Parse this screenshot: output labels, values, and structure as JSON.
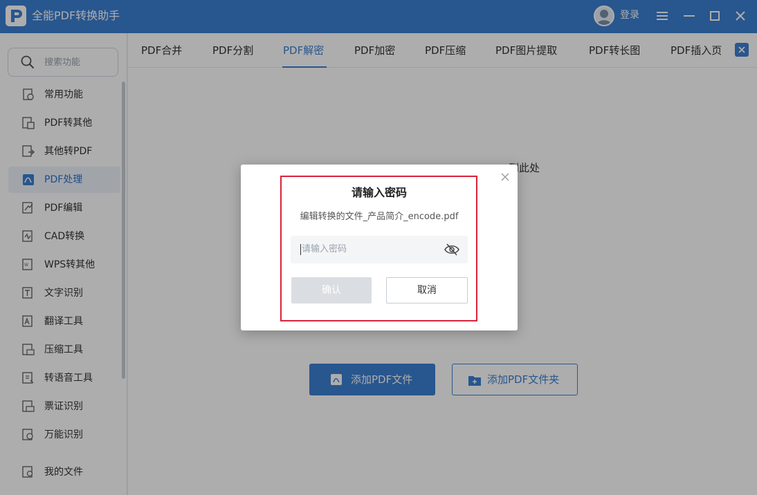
{
  "app": {
    "title": "全能PDF转换助手",
    "login_label": "登录"
  },
  "colors": {
    "brand": "#3b7fd1",
    "highlight_border": "#d9233a"
  },
  "sidebar": {
    "search_placeholder": "搜索功能",
    "items": [
      {
        "label": "常用功能",
        "icon": "star-doc-icon"
      },
      {
        "label": "PDF转其他",
        "icon": "pdf-convert-icon"
      },
      {
        "label": "其他转PDF",
        "icon": "to-pdf-icon"
      },
      {
        "label": "PDF处理",
        "icon": "pdf-process-icon",
        "active": true
      },
      {
        "label": "PDF编辑",
        "icon": "pdf-edit-icon"
      },
      {
        "label": "CAD转换",
        "icon": "cad-icon"
      },
      {
        "label": "WPS转其他",
        "icon": "wps-icon"
      },
      {
        "label": "文字识别",
        "icon": "ocr-icon"
      },
      {
        "label": "翻译工具",
        "icon": "translate-icon"
      },
      {
        "label": "压缩工具",
        "icon": "compress-icon"
      },
      {
        "label": "转语音工具",
        "icon": "voice-icon"
      },
      {
        "label": "票证识别",
        "icon": "ticket-icon"
      },
      {
        "label": "万能识别",
        "icon": "universal-scan-icon"
      },
      {
        "label": "我的文件",
        "icon": "my-files-icon"
      }
    ]
  },
  "tabs": [
    {
      "label": "PDF合并"
    },
    {
      "label": "PDF分割"
    },
    {
      "label": "PDF解密",
      "active": true
    },
    {
      "label": "PDF加密"
    },
    {
      "label": "PDF压缩"
    },
    {
      "label": "PDF图片提取"
    },
    {
      "label": "PDF转长图"
    },
    {
      "label": "PDF插入页"
    }
  ],
  "content": {
    "drop_hint": "到此处",
    "add_file_label": "添加PDF文件",
    "add_folder_label": "添加PDF文件夹"
  },
  "dialog": {
    "title": "请输入密码",
    "filename": "编辑转换的文件_产品简介_encode.pdf",
    "password_placeholder": "请输入密码",
    "confirm_label": "确认",
    "cancel_label": "取消"
  }
}
